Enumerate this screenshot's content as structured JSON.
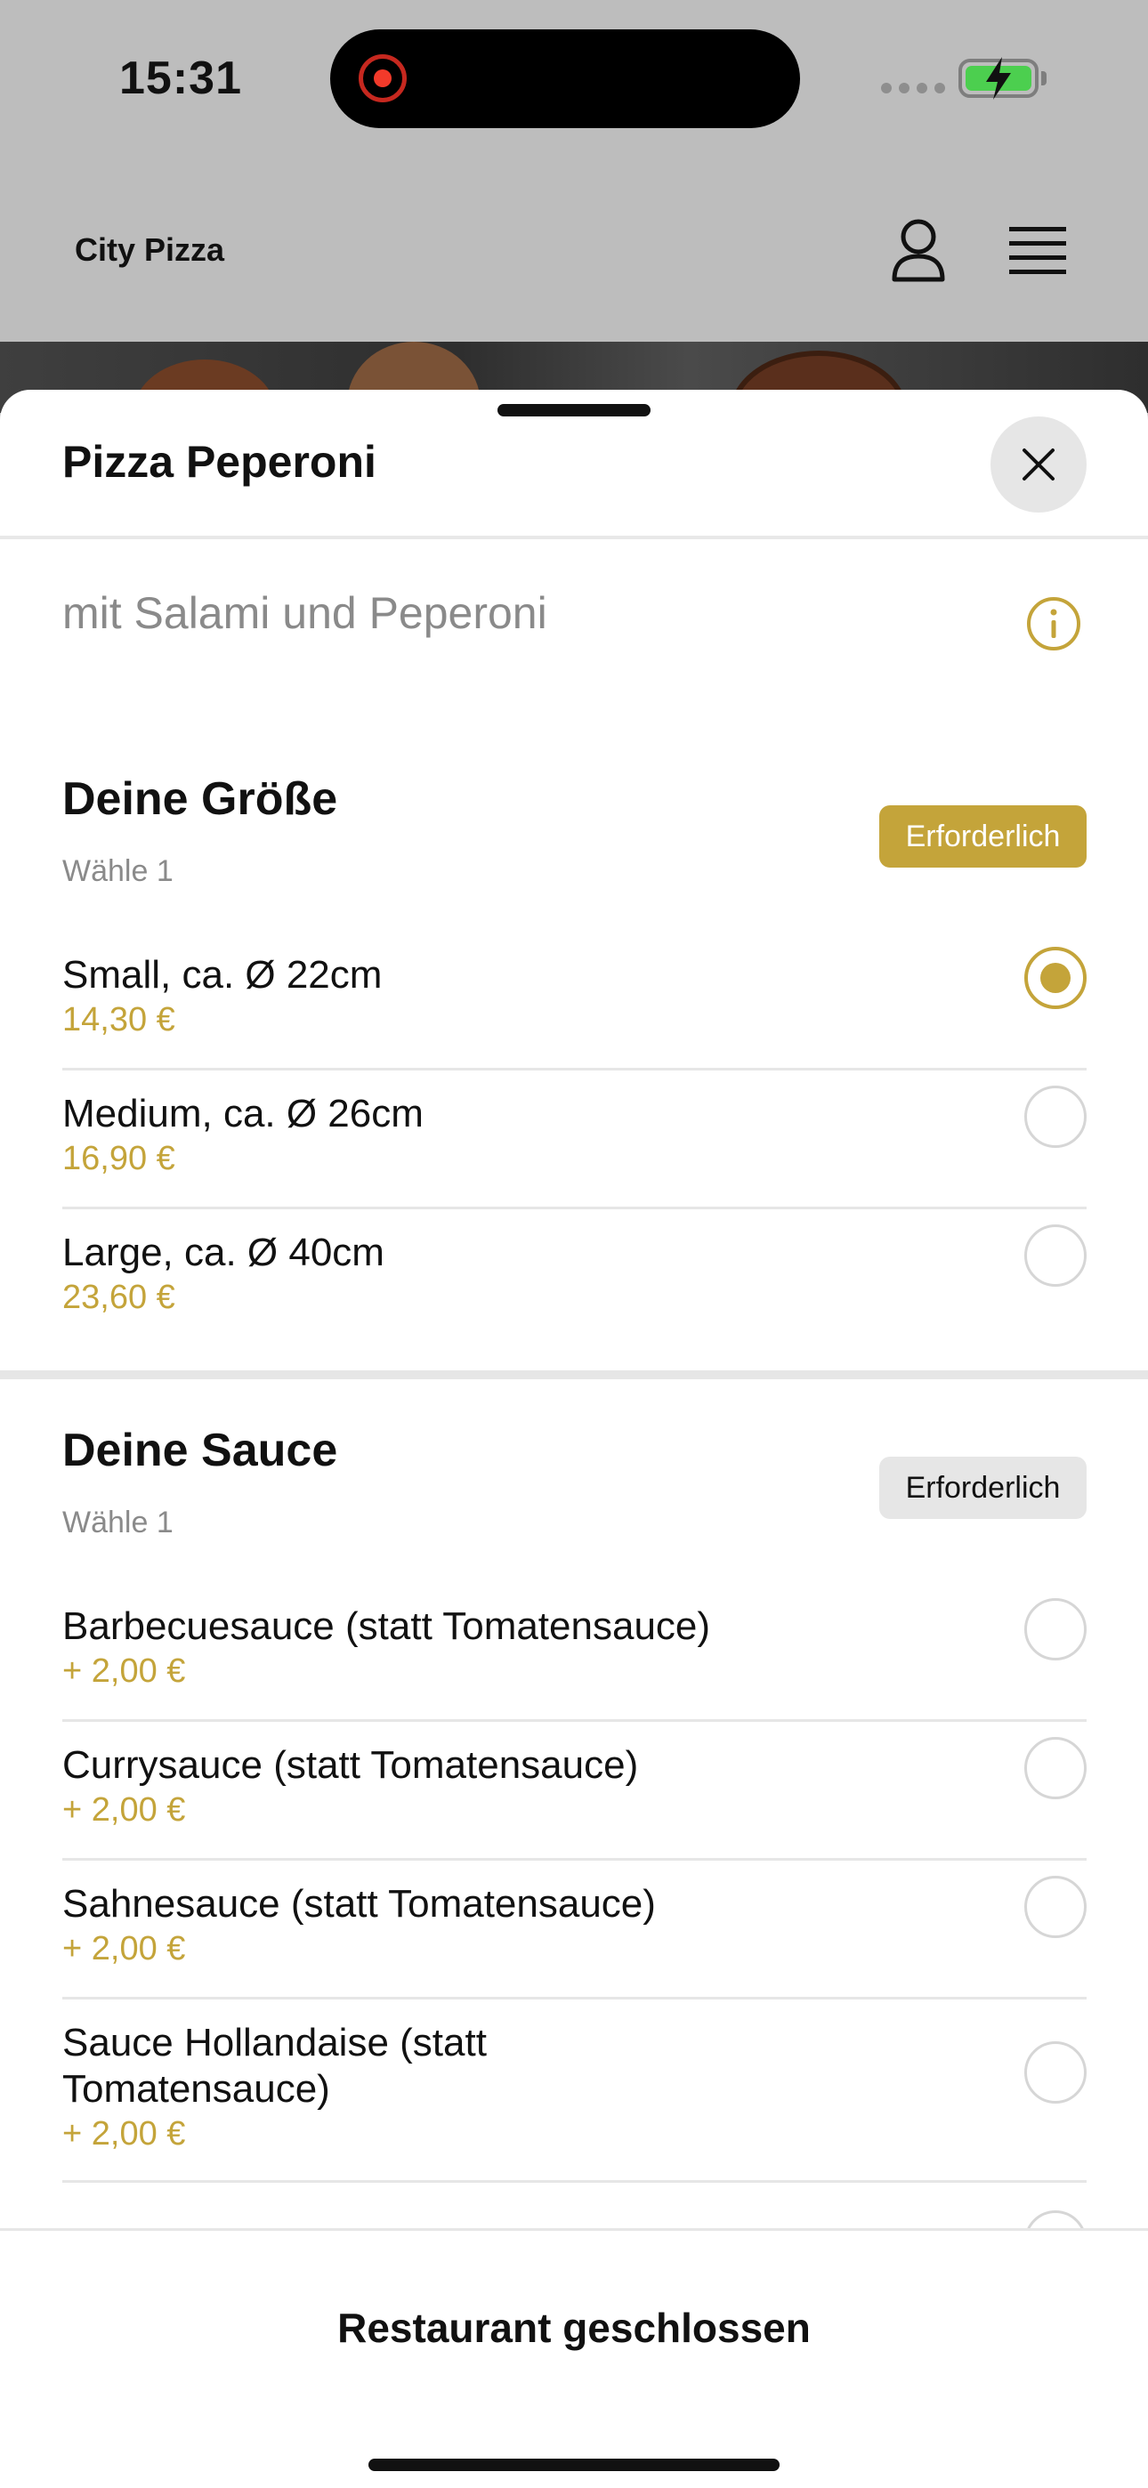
{
  "status_bar": {
    "time": "15:31"
  },
  "header": {
    "brand": "City Pizza",
    "profile_icon": "person-icon",
    "menu_icon": "hamburger-icon"
  },
  "sheet": {
    "title": "Pizza Peperoni",
    "description": "mit Salami und Peperoni",
    "close_icon": "close-icon",
    "info_icon": "info-icon"
  },
  "groups": [
    {
      "title": "Deine Größe",
      "subtitle": "Wähle 1",
      "badge": "Erforderlich",
      "options": [
        {
          "name": "Small, ca. Ø 22cm",
          "price": "14,30 €",
          "selected": true
        },
        {
          "name": "Medium, ca. Ø 26cm",
          "price": "16,90 €",
          "selected": false
        },
        {
          "name": "Large, ca. Ø 40cm",
          "price": "23,60 €",
          "selected": false
        }
      ]
    },
    {
      "title": "Deine Sauce",
      "subtitle": "Wähle 1",
      "badge": "Erforderlich",
      "options": [
        {
          "name": "Barbecuesauce (statt Tomatensauce)",
          "price": "+ 2,00 €",
          "selected": false
        },
        {
          "name": "Currysauce (statt Tomatensauce)",
          "price": "+ 2,00 €",
          "selected": false
        },
        {
          "name": "Sahnesauce (statt Tomatensauce)",
          "price": "+ 2,00 €",
          "selected": false
        },
        {
          "name": "Sauce Hollandaise (statt Tomatensauce)",
          "price": "+ 2,00 €",
          "selected": false
        }
      ]
    }
  ],
  "bottom": {
    "label": "Restaurant geschlossen"
  },
  "colors": {
    "accent": "#c4a43a",
    "divider": "#e6e6e6"
  }
}
